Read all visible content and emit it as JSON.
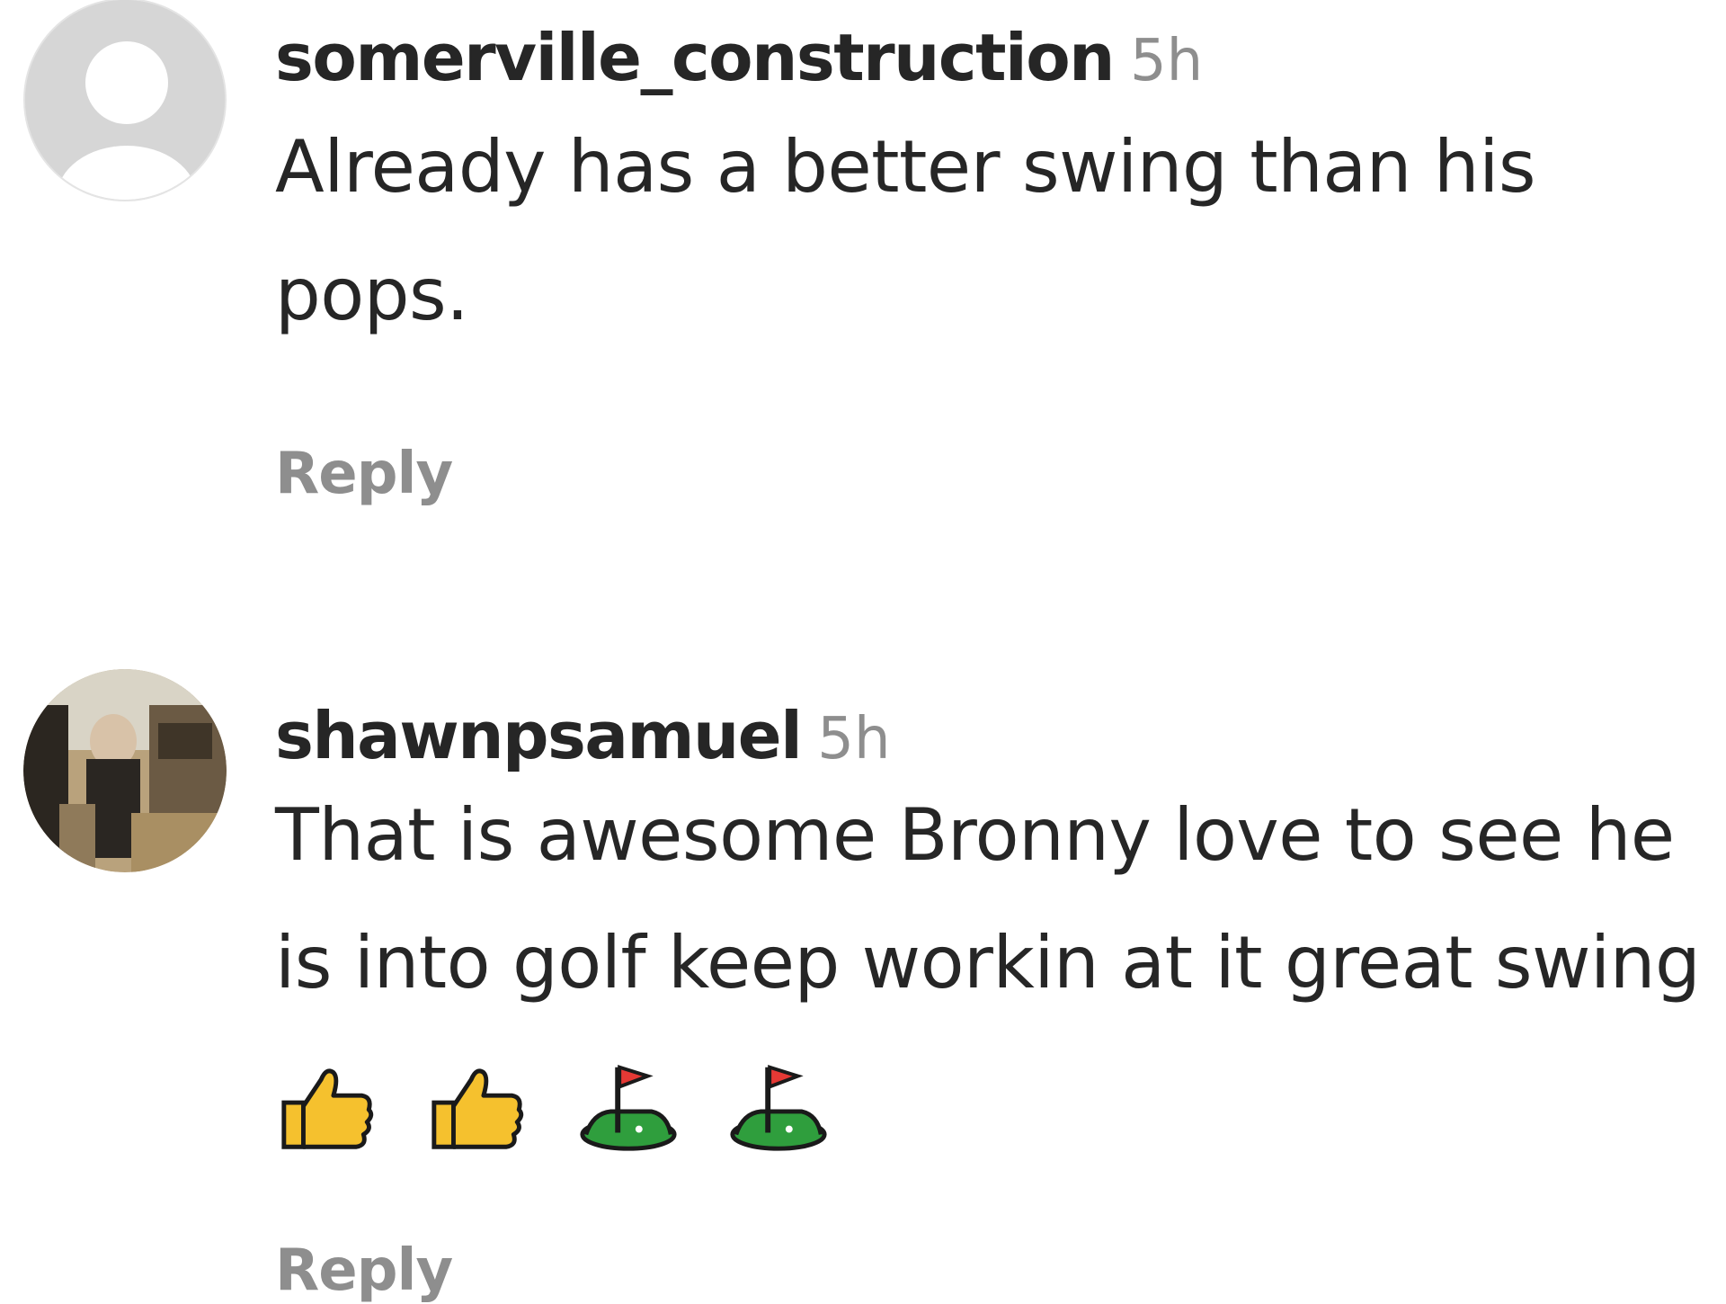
{
  "comments": [
    {
      "username": "somerville_construction",
      "time": "5h",
      "text": "Already has a better swing than his pops.",
      "reply_label": "Reply",
      "avatar": "default-avatar"
    },
    {
      "username": "shawnpsamuel",
      "time": "5h",
      "text": "That is awesome Bronny love to see he is into golf keep workin at it great swing",
      "emojis": [
        "thumbs-up-icon",
        "thumbs-up-icon",
        "golf-flag-icon",
        "golf-flag-icon"
      ],
      "reply_label": "Reply",
      "avatar": "user-photo-avatar"
    }
  ],
  "colors": {
    "text": "#262626",
    "muted": "#8e8e8e",
    "thumbs_yellow": "#f5c12e",
    "golf_green": "#2f9e3d",
    "flag_red": "#e53935"
  }
}
